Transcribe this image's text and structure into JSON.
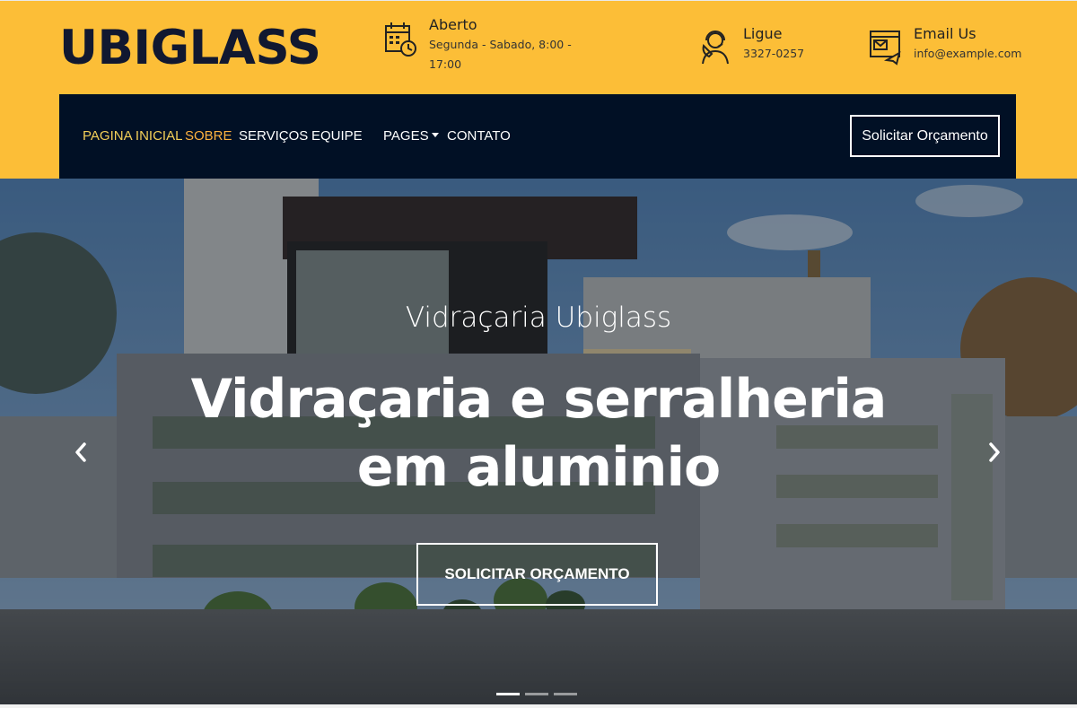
{
  "brand": {
    "logo": "UBIGLASS"
  },
  "contact": {
    "hours_title": "Aberto",
    "hours_value": "Segunda - Sabado, 8:00 - 17:00",
    "phone_title": "Ligue",
    "phone_value": "3327-0257",
    "email_title": "Email Us",
    "email_value": "info@example.com"
  },
  "nav": {
    "items": [
      {
        "label": "PAGINA INICIAL"
      },
      {
        "label": "SOBRE"
      },
      {
        "label": "SERVIÇOS"
      },
      {
        "label": "EQUIPE"
      },
      {
        "label": "PAGES"
      },
      {
        "label": "CONTATO"
      }
    ],
    "quote_button": "Solicitar Orçamento"
  },
  "hero": {
    "subtitle": "Vidraçaria Ubiglass",
    "title": "Vidraçaria e serralheria em aluminio",
    "button": "SOLICITAR ORÇAMENTO",
    "active_slide": 1,
    "slide_count": 3
  },
  "colors": {
    "topbar": "#fcbe37",
    "navbar": "#011025",
    "logo": "#111830",
    "nav_home": "#f4cf58",
    "nav_active": "#ffb23f"
  },
  "icons": {
    "hours": "calendar-clock-icon",
    "phone": "support-agent-icon",
    "email": "email-browser-icon",
    "prev": "chevron-left-icon",
    "next": "chevron-right-icon"
  }
}
